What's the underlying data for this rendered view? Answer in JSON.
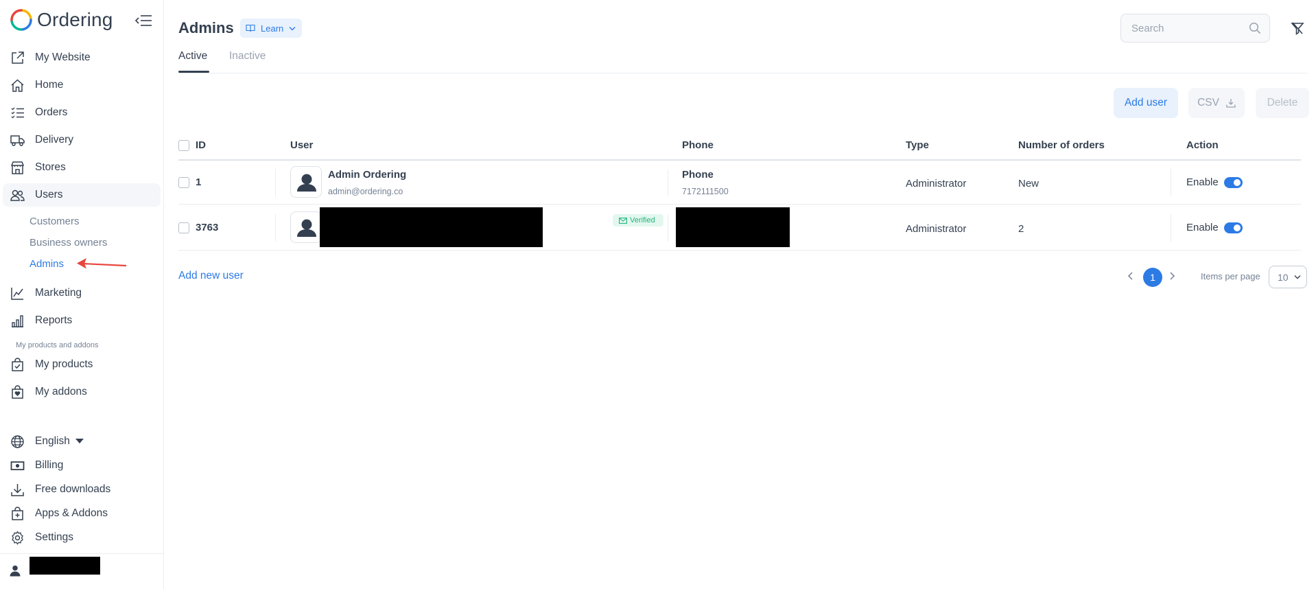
{
  "sidebar": {
    "brand": "Ordering",
    "nav": [
      {
        "label": "My Website",
        "icon": "external-link-icon"
      },
      {
        "label": "Home",
        "icon": "home-icon"
      },
      {
        "label": "Orders",
        "icon": "list-icon"
      },
      {
        "label": "Delivery",
        "icon": "truck-icon"
      },
      {
        "label": "Stores",
        "icon": "store-icon"
      },
      {
        "label": "Users",
        "icon": "users-icon"
      }
    ],
    "users_sub": [
      "Customers",
      "Business owners",
      "Admins"
    ],
    "nav2": [
      {
        "label": "Marketing",
        "icon": "chart-line-icon"
      },
      {
        "label": "Reports",
        "icon": "bar-chart-icon"
      }
    ],
    "section_caption": "My products and addons",
    "products": [
      {
        "label": "My products",
        "icon": "bag-check-icon"
      },
      {
        "label": "My addons",
        "icon": "bag-heart-icon"
      }
    ],
    "language": "English",
    "bottom": [
      {
        "label": "Billing",
        "icon": "cash-icon"
      },
      {
        "label": "Free downloads",
        "icon": "download-icon"
      },
      {
        "label": "Apps & Addons",
        "icon": "bag-plus-icon"
      },
      {
        "label": "Settings",
        "icon": "gear-icon"
      }
    ]
  },
  "header": {
    "title": "Admins",
    "learn_label": "Learn",
    "search_placeholder": "Search"
  },
  "tabs": [
    "Active",
    "Inactive"
  ],
  "actions": {
    "add_user": "Add user",
    "csv": "CSV",
    "delete": "Delete"
  },
  "table": {
    "columns": [
      "ID",
      "User",
      "Phone",
      "Type",
      "Number of orders",
      "Action"
    ],
    "rows": [
      {
        "id": "1",
        "user_name": "Admin Ordering",
        "user_email": "admin@ordering.co",
        "phone_title": "Phone",
        "phone_number": "7172111500",
        "type": "Administrator",
        "orders": "New",
        "action": "Enable",
        "enabled": true
      },
      {
        "id": "3763",
        "verified": "Verified",
        "type": "Administrator",
        "orders": "2",
        "action": "Enable",
        "enabled": true
      }
    ]
  },
  "footer": {
    "add_new_user": "Add new user",
    "current_page": "1",
    "items_per_page_label": "Items per page",
    "items_per_page_value": "10"
  },
  "colors": {
    "accent": "#2c7be5",
    "text": "#344050",
    "muted": "#748194",
    "annotation_arrow": "#e8453c"
  }
}
